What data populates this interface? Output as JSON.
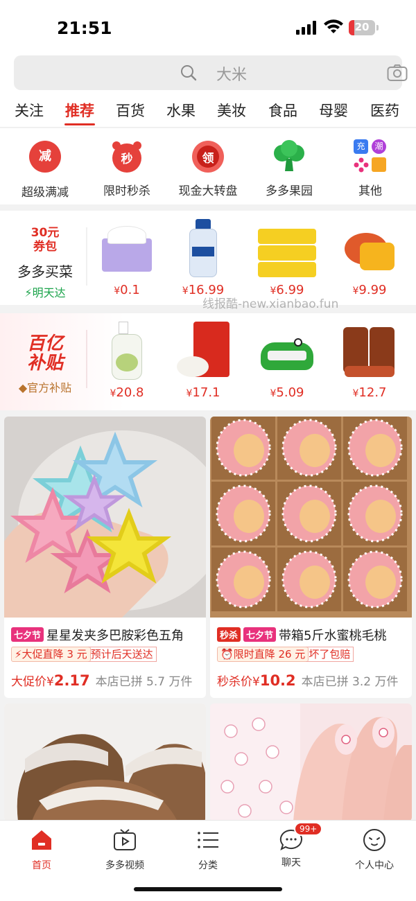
{
  "status_bar": {
    "time": "21:51",
    "battery": "20",
    "battery_level": 0.2
  },
  "search": {
    "placeholder": "大米"
  },
  "tabs": [
    {
      "label": "关注",
      "active": false
    },
    {
      "label": "推荐",
      "active": true
    },
    {
      "label": "百货",
      "active": false
    },
    {
      "label": "水果",
      "active": false
    },
    {
      "label": "美妆",
      "active": false
    },
    {
      "label": "食品",
      "active": false
    },
    {
      "label": "母婴",
      "active": false
    },
    {
      "label": "医药",
      "active": false
    }
  ],
  "quick_entries": [
    {
      "label": "超级满减",
      "icon": "discount-icon",
      "glyph": "减"
    },
    {
      "label": "限时秒杀",
      "icon": "flash-sale-clock-icon",
      "glyph": "秒"
    },
    {
      "label": "现金大转盘",
      "icon": "lucky-wheel-icon",
      "glyph": "领"
    },
    {
      "label": "多多果园",
      "icon": "orchard-tree-icon"
    },
    {
      "label": "其他",
      "icon": "more-apps-icon",
      "mini": [
        "充",
        "潮"
      ]
    }
  ],
  "duoduo_maicai": {
    "coupon_line1": "30元",
    "coupon_line2": "券包",
    "title": "多多买菜",
    "subtitle": "明天达",
    "products": [
      {
        "name": "tissue",
        "price": "0.1"
      },
      {
        "name": "shampoo",
        "price": "16.99"
      },
      {
        "name": "wet-wipes",
        "price": "6.99"
      },
      {
        "name": "mango",
        "price": "9.99"
      }
    ]
  },
  "subsidy": {
    "title_line1": "百亿",
    "title_line2": "补贴",
    "subtitle": "官方补贴",
    "products": [
      {
        "name": "handwash",
        "price": "20.8"
      },
      {
        "name": "rice",
        "price": "17.1"
      },
      {
        "name": "crocodile-toy",
        "price": "5.09"
      },
      {
        "name": "jerky",
        "price": "12.7"
      }
    ]
  },
  "currency": "¥",
  "watermark": "线报酷-new.xianbao.fun",
  "feed": [
    {
      "tags": [
        "七夕节"
      ],
      "title": "星星发夹多巴胺彩色五角",
      "promo_main": "大促直降 3 元",
      "promo_extra": "预计后天送达",
      "price_label": "大促价",
      "price": "2.17",
      "sold": "本店已拼 5.7 万件"
    },
    {
      "tags": [
        "秒杀",
        "七夕节"
      ],
      "title": "带箱5斤水蜜桃毛桃",
      "promo_main": "限时直降 26 元",
      "promo_extra": "坏了包赔",
      "price_label": "秒杀价",
      "price": "10.2",
      "sold": "本店已拼 3.2 万件"
    },
    {
      "name": "taro"
    },
    {
      "name": "nail-stickers"
    }
  ],
  "bottom_nav": [
    {
      "label": "首页",
      "icon": "home-icon",
      "active": true
    },
    {
      "label": "多多视频",
      "icon": "video-icon",
      "active": false
    },
    {
      "label": "分类",
      "icon": "category-list-icon",
      "active": false
    },
    {
      "label": "聊天",
      "icon": "chat-icon",
      "active": false,
      "badge": "99+"
    },
    {
      "label": "个人中心",
      "icon": "profile-icon",
      "active": false
    }
  ],
  "colors": {
    "brand": "#e02e24",
    "tag_pink": "#e8327c"
  }
}
